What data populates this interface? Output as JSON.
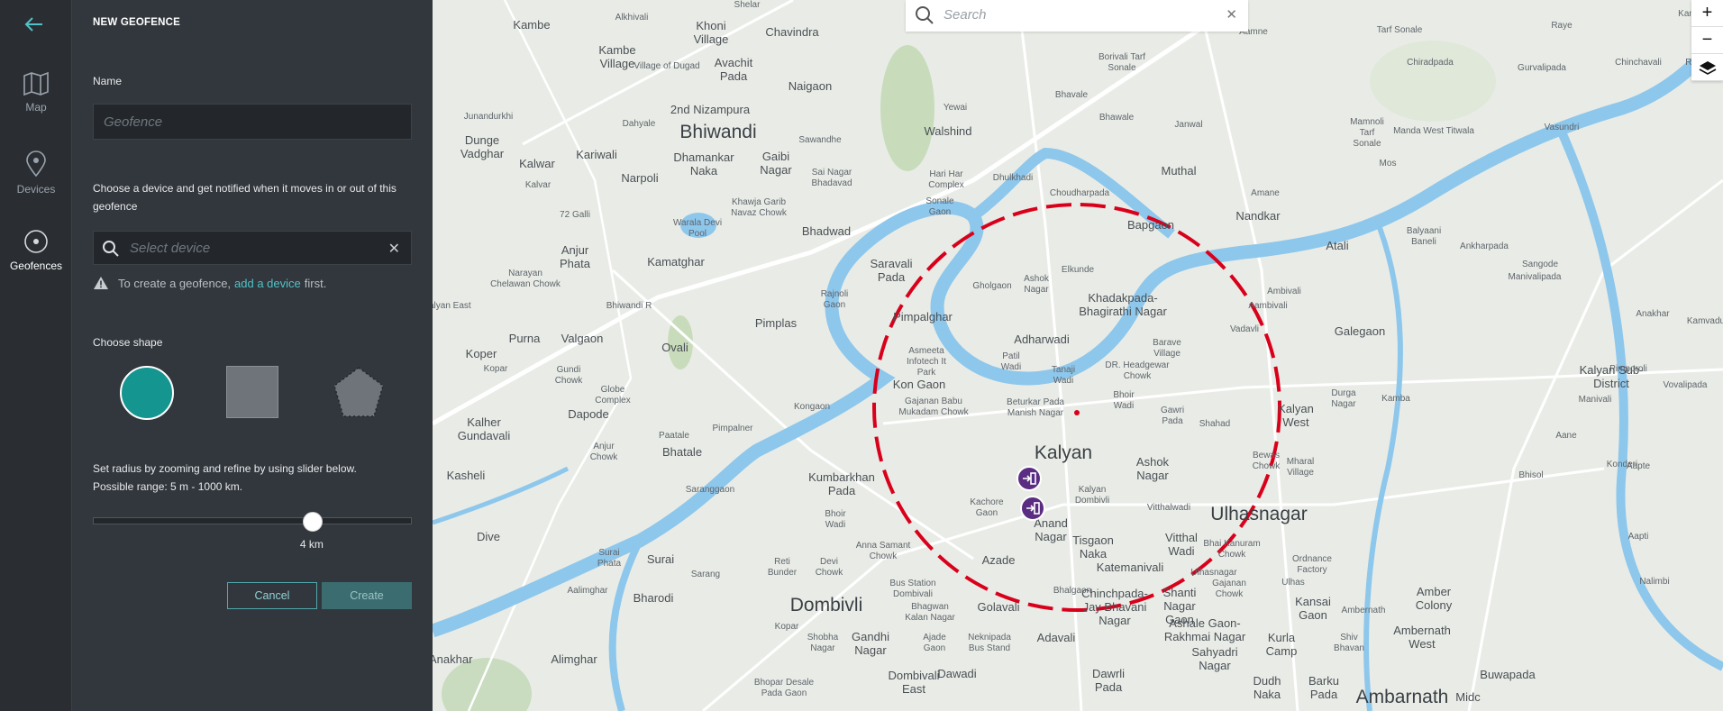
{
  "nav": {
    "items": [
      {
        "label": "Map",
        "icon": "map-icon"
      },
      {
        "label": "Devices",
        "icon": "pin-icon"
      },
      {
        "label": "Geofences",
        "icon": "target-icon",
        "active": true
      }
    ]
  },
  "panel": {
    "title": "NEW GEOFENCE",
    "name_label": "Name",
    "name_placeholder": "Geofence",
    "device_desc": "Choose a device and get notified when it moves in or out of this geofence",
    "device_placeholder": "Select device",
    "warning_pre": "To create a geofence,",
    "warning_link": "add a device",
    "warning_post": "first.",
    "shape_label": "Choose shape",
    "radius_line1": "Set radius by zooming and refine by using slider below.",
    "radius_line2": "Possible range: 5 m - 1000 km.",
    "slider_value": "4 km",
    "slider_fraction": 0.69,
    "cancel_label": "Cancel",
    "create_label": "Create",
    "accent": "#15958f"
  },
  "map": {
    "search_placeholder": "Search",
    "zoom_in": "+",
    "zoom_out": "−",
    "geofence_color": "#d9001b",
    "places": [
      {
        "t": "Shelar",
        "c": "small"
      },
      {
        "t": "Kambe",
        "c": ""
      },
      {
        "t": "Alkhivali",
        "c": "small"
      },
      {
        "t": "Khoni Village",
        "c": ""
      },
      {
        "t": "Chavindra",
        "c": ""
      },
      {
        "t": "Kambe Village",
        "c": ""
      },
      {
        "t": "Avachit Pada",
        "c": ""
      },
      {
        "t": "Naigaon",
        "c": ""
      },
      {
        "t": "Junandurkhi",
        "c": "small"
      },
      {
        "t": "2nd Nizampura",
        "c": ""
      },
      {
        "t": "Bhiwandi",
        "c": "city"
      },
      {
        "t": "Dahyale",
        "c": "small"
      },
      {
        "t": "Sawandhe",
        "c": "small"
      },
      {
        "t": "Dunge Vadghar",
        "c": ""
      },
      {
        "t": "Kalwar",
        "c": ""
      },
      {
        "t": "Kariwali",
        "c": ""
      },
      {
        "t": "Dhamankar Naka",
        "c": ""
      },
      {
        "t": "Gaibi Nagar",
        "c": ""
      },
      {
        "t": "Narpoli",
        "c": ""
      },
      {
        "t": "Sai Nagar Bhadavad",
        "c": "small"
      },
      {
        "t": "Hari Har Complex",
        "c": "small"
      },
      {
        "t": "Sonale Gaon",
        "c": "small"
      },
      {
        "t": "Walshind",
        "c": ""
      },
      {
        "t": "Yewai",
        "c": "small"
      },
      {
        "t": "Dhulkhadi",
        "c": "small"
      },
      {
        "t": "Kalvar",
        "c": "small"
      },
      {
        "t": "72 Galli",
        "c": "small"
      },
      {
        "t": "Khawja Garib Navaz Chowk",
        "c": "small"
      },
      {
        "t": "Warala Devi Pool",
        "c": "small"
      },
      {
        "t": "Bhadwad",
        "c": ""
      },
      {
        "t": "Anjur Phata",
        "c": ""
      },
      {
        "t": "Kamatghar",
        "c": ""
      },
      {
        "t": "Saravali Pada",
        "c": ""
      },
      {
        "t": "Narayan Chelawan Chowk",
        "c": "small"
      },
      {
        "t": "Rajnoli Gaon",
        "c": "small"
      },
      {
        "t": "Bhiwandi R",
        "c": "small"
      },
      {
        "t": "Pimpalghar",
        "c": ""
      },
      {
        "t": "Pimplas",
        "c": ""
      },
      {
        "t": "Purna",
        "c": ""
      },
      {
        "t": "Valgaon",
        "c": ""
      },
      {
        "t": "Ovali",
        "c": ""
      },
      {
        "t": "Koper",
        "c": ""
      },
      {
        "t": "Kopar",
        "c": "small"
      },
      {
        "t": "Gundi Chowk",
        "c": "small"
      },
      {
        "t": "Globe Complex",
        "c": "small"
      },
      {
        "t": "Dapode",
        "c": ""
      },
      {
        "t": "Kongaon",
        "c": "small"
      },
      {
        "t": "Kalher Gundavali",
        "c": ""
      },
      {
        "t": "Paatale",
        "c": "small"
      },
      {
        "t": "Pimpalner",
        "c": "small"
      },
      {
        "t": "Anjur Chowk",
        "c": "small"
      },
      {
        "t": "Bhatale",
        "c": ""
      },
      {
        "t": "Kasheli",
        "c": ""
      },
      {
        "t": "Saranggaon",
        "c": "small"
      },
      {
        "t": "Kumbarkhan Pada",
        "c": ""
      },
      {
        "t": "Bhoir Wadi",
        "c": "small"
      },
      {
        "t": "Dive",
        "c": ""
      },
      {
        "t": "Surai Phata",
        "c": "small"
      },
      {
        "t": "Surai",
        "c": ""
      },
      {
        "t": "Anna Samant Chowk",
        "c": "small"
      },
      {
        "t": "Devi Chowk",
        "c": "small"
      },
      {
        "t": "Reti Bunder",
        "c": "small"
      },
      {
        "t": "Sarang",
        "c": "small"
      },
      {
        "t": "Aalimghar",
        "c": "small"
      },
      {
        "t": "Bharodi",
        "c": ""
      },
      {
        "t": "Bus Station Dombivali",
        "c": "small"
      },
      {
        "t": "Dombivli",
        "c": "city"
      },
      {
        "t": "Kopar",
        "c": "small"
      },
      {
        "t": "Bhagwan Kalan Nagar",
        "c": "small"
      },
      {
        "t": "Shobha Nagar",
        "c": "small"
      },
      {
        "t": "Gandhi Nagar",
        "c": ""
      },
      {
        "t": "Ajade Gaon",
        "c": "small"
      },
      {
        "t": "Neknipada Bus Stand",
        "c": "small"
      },
      {
        "t": "Alimghar",
        "c": ""
      },
      {
        "t": "Dombivali East",
        "c": ""
      },
      {
        "t": "Dawadi",
        "c": ""
      },
      {
        "t": "Bhopar Desale Pada Gaon",
        "c": "small"
      },
      {
        "t": "Azade",
        "c": ""
      },
      {
        "t": "Golavali",
        "c": ""
      },
      {
        "t": "Adavali",
        "c": ""
      },
      {
        "t": "Dawrli Pada",
        "c": ""
      },
      {
        "t": "Kon Gaon",
        "c": ""
      },
      {
        "t": "Asmeeta Infotech It Park",
        "c": "small"
      },
      {
        "t": "Gajanan Babu Mukadam Chowk",
        "c": "small"
      },
      {
        "t": "Patil Wadi",
        "c": "small"
      },
      {
        "t": "Adharwadi",
        "c": ""
      },
      {
        "t": "Gholgaon",
        "c": "small"
      },
      {
        "t": "Ashok Nagar",
        "c": "small"
      },
      {
        "t": "Elkunde",
        "c": "small"
      },
      {
        "t": "Khadakpada-Bhagirathi Nagar",
        "c": ""
      },
      {
        "t": "Tanaji Wadi",
        "c": "small"
      },
      {
        "t": "DR. Headgewar Chowk",
        "c": "small"
      },
      {
        "t": "Barave Village",
        "c": "small"
      },
      {
        "t": "Beturkar Pada Manish Nagar",
        "c": "small"
      },
      {
        "t": "Bhoir Wadi",
        "c": "small"
      },
      {
        "t": "Gawri Pada",
        "c": "small"
      },
      {
        "t": "Shahad",
        "c": "small"
      },
      {
        "t": "Kalyan",
        "c": "city"
      },
      {
        "t": "Ashok Nagar",
        "c": ""
      },
      {
        "t": "Kalyan Dombivli",
        "c": "small"
      },
      {
        "t": "Kachore Gaon",
        "c": "small"
      },
      {
        "t": "Anand Nagar",
        "c": ""
      },
      {
        "t": "Tisgaon Naka",
        "c": ""
      },
      {
        "t": "Katemanivali",
        "c": ""
      },
      {
        "t": "Vitthalwadi",
        "c": "small"
      },
      {
        "t": "Vitthal Wadi",
        "c": ""
      },
      {
        "t": "Ulhasnagar",
        "c": "city"
      },
      {
        "t": "Bewas Chowk",
        "c": "small"
      },
      {
        "t": "Mharal Village",
        "c": "small"
      },
      {
        "t": "Bhai Kanuram Chowk",
        "c": "small"
      },
      {
        "t": "Ulhasnagar",
        "c": "small"
      },
      {
        "t": "Gajanan Chowk",
        "c": "small"
      },
      {
        "t": "Ulhas",
        "c": "small"
      },
      {
        "t": "Ordnance Factory",
        "c": "small"
      },
      {
        "t": "Chinchpada-Jay Bhavani Nagar",
        "c": ""
      },
      {
        "t": "Shanti Nagar Gaon",
        "c": ""
      },
      {
        "t": "Ashale Gaon-Rakhmai Nagar",
        "c": ""
      },
      {
        "t": "Sahyadri Nagar",
        "c": ""
      },
      {
        "t": "Kurla Camp",
        "c": ""
      },
      {
        "t": "Kansai Gaon",
        "c": ""
      },
      {
        "t": "Ambernath",
        "c": "small"
      },
      {
        "t": "Shiv Bhavan",
        "c": "small"
      },
      {
        "t": "Ambernath West",
        "c": ""
      },
      {
        "t": "Dudh Naka",
        "c": ""
      },
      {
        "t": "Barku Pada",
        "c": ""
      },
      {
        "t": "Ambarnath",
        "c": "city"
      },
      {
        "t": "Midc",
        "c": ""
      },
      {
        "t": "Buwapada",
        "c": ""
      },
      {
        "t": "Amber Colony",
        "c": ""
      },
      {
        "t": "Bhalgaon",
        "c": "small"
      },
      {
        "t": "Bhavale",
        "c": "small"
      },
      {
        "t": "Bhawale",
        "c": "small"
      },
      {
        "t": "Borivali Tarf Sonale",
        "c": "small"
      },
      {
        "t": "Aamne",
        "c": "small"
      },
      {
        "t": "Janwal",
        "c": "small"
      },
      {
        "t": "Muthal",
        "c": ""
      },
      {
        "t": "Choudharpada",
        "c": "small"
      },
      {
        "t": "Amane",
        "c": "small"
      },
      {
        "t": "Bapgaon",
        "c": ""
      },
      {
        "t": "Nandkar",
        "c": ""
      },
      {
        "t": "Atali",
        "c": ""
      },
      {
        "t": "Ambivali",
        "c": "small"
      },
      {
        "t": "Aambivali",
        "c": "small"
      },
      {
        "t": "Vadavli",
        "c": "small"
      },
      {
        "t": "Galegaon",
        "c": ""
      },
      {
        "t": "Kalyan West",
        "c": ""
      },
      {
        "t": "Durga Nagar",
        "c": "small"
      },
      {
        "t": "Kamba",
        "c": "small"
      },
      {
        "t": "Balyaani Baneli",
        "c": "small"
      },
      {
        "t": "Ankharpada",
        "c": "small"
      },
      {
        "t": "Sangode",
        "c": "small"
      },
      {
        "t": "Manivalipada",
        "c": "small"
      },
      {
        "t": "Kalyan Sub-District",
        "c": ""
      },
      {
        "t": "Pimporoli",
        "c": "small"
      },
      {
        "t": "Vovalipada",
        "c": "small"
      },
      {
        "t": "Manivali",
        "c": "small"
      },
      {
        "t": "Aane",
        "c": "small"
      },
      {
        "t": "Aapte",
        "c": "small"
      },
      {
        "t": "Bhisol",
        "c": "small"
      },
      {
        "t": "Aapti",
        "c": "small"
      },
      {
        "t": "Nalimbi",
        "c": "small"
      },
      {
        "t": "Anakhar",
        "c": "small"
      },
      {
        "t": "Chiradpada",
        "c": "small"
      },
      {
        "t": "Gurvalipada",
        "c": "small"
      },
      {
        "t": "Chinchavali",
        "c": "small"
      },
      {
        "t": "Runde",
        "c": "small"
      },
      {
        "t": "Raye",
        "c": "small"
      },
      {
        "t": "Kamba",
        "c": "small"
      },
      {
        "t": "Tarf Sonale",
        "c": "small"
      },
      {
        "t": "Mamnoli Tarf Sonale",
        "c": "small"
      },
      {
        "t": "Manda West Titwala",
        "c": "small"
      },
      {
        "t": "Vasundri",
        "c": "small"
      },
      {
        "t": "Mos",
        "c": "small"
      },
      {
        "t": "Konderi",
        "c": "small"
      },
      {
        "t": "Kalyan East",
        "c": "small"
      },
      {
        "t": "Village of Dugad",
        "c": "small"
      },
      {
        "t": "Kamvadu",
        "c": "small"
      },
      {
        "t": "Anakhar",
        "c": "small"
      },
      {
        "t": "Nagar",
        "c": ""
      }
    ]
  }
}
